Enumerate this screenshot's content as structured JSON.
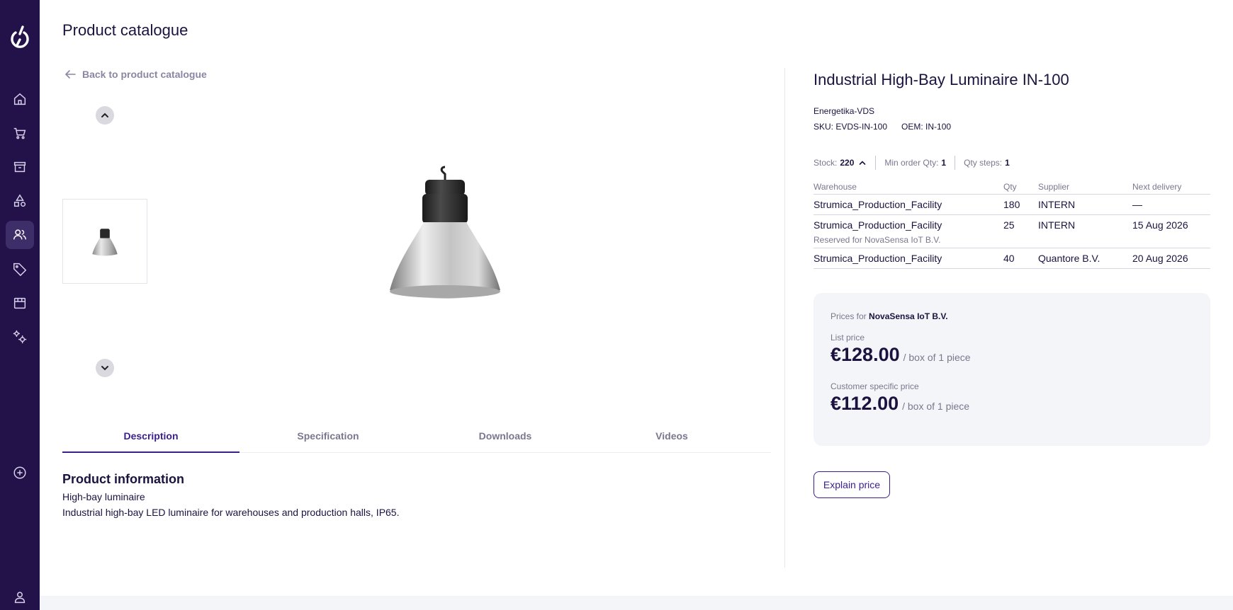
{
  "header": {
    "title": "Product catalogue"
  },
  "nav": {
    "items": [
      "home-icon",
      "cart-icon",
      "archive-icon",
      "shapes-icon",
      "users-icon",
      "tag-icon",
      "store-icon",
      "settings-icon",
      "add-circle-icon",
      "user-icon"
    ],
    "active": "users-icon"
  },
  "gallery": {
    "back_label": "Back to product catalogue"
  },
  "tabs": [
    {
      "label": "Description",
      "active": true
    },
    {
      "label": "Specification",
      "active": false
    },
    {
      "label": "Downloads",
      "active": false
    },
    {
      "label": "Videos",
      "active": false
    }
  ],
  "description": {
    "heading": "Product information",
    "subtitle": "High-bay luminaire",
    "text": "Industrial high-bay LED luminaire for warehouses and production halls, IP65."
  },
  "product": {
    "title": "Industrial High-Bay Luminaire IN-100",
    "brand": "Energetika-VDS",
    "sku": "SKU: EVDS-IN-100",
    "oem": "OEM: IN-100"
  },
  "stock": {
    "stock_label": "Stock:",
    "stock_value": "220",
    "min_order_label": "Min order Qty:",
    "min_order_value": "1",
    "qty_steps_label": "Qty steps:",
    "qty_steps_value": "1"
  },
  "warehouse_table": {
    "headers": [
      "Warehouse",
      "Qty",
      "Supplier",
      "Next delivery"
    ],
    "rows": [
      {
        "warehouse": "Strumica_Production_Facility",
        "qty": "180",
        "supplier": "INTERN",
        "next_delivery": "—",
        "note": ""
      },
      {
        "warehouse": "Strumica_Production_Facility",
        "qty": "25",
        "supplier": "INTERN",
        "next_delivery": "15 Aug 2026",
        "note": "Reserved for NovaSensa IoT B.V."
      },
      {
        "warehouse": "Strumica_Production_Facility",
        "qty": "40",
        "supplier": "Quantore B.V.",
        "next_delivery": "20 Aug 2026",
        "note": ""
      }
    ]
  },
  "pricing": {
    "prices_for_label": "Prices for",
    "customer": "NovaSensa IoT B.V.",
    "list_price_label": "List price",
    "list_price": "€128.00",
    "list_price_unit": "/ box of 1 piece",
    "customer_price_label": "Customer specific price",
    "customer_price": "€112.00",
    "customer_price_unit": "/ box of 1 piece"
  },
  "explain_button": "Explain price",
  "colors": {
    "sidebar": "#23124a",
    "accent": "#3a1f8c",
    "text": "#1b1240",
    "muted": "#7a778e",
    "card": "#f4f5f8"
  }
}
